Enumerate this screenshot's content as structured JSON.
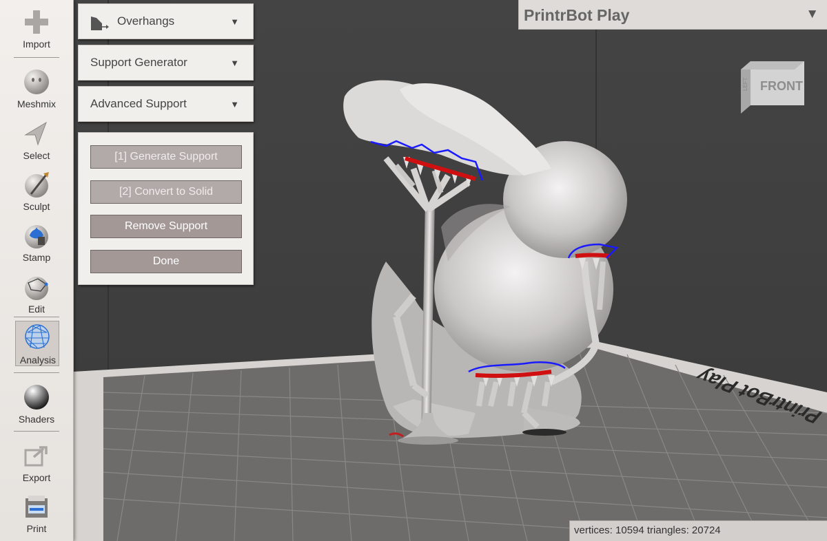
{
  "toolbar": {
    "items": [
      {
        "label": "Import",
        "icon": "plus-icon"
      },
      {
        "label": "Meshmix",
        "icon": "face-sphere-icon"
      },
      {
        "label": "Select",
        "icon": "cursor-arrow-icon"
      },
      {
        "label": "Sculpt",
        "icon": "brush-sphere-icon"
      },
      {
        "label": "Stamp",
        "icon": "stamp-icon"
      },
      {
        "label": "Edit",
        "icon": "edit-mesh-icon"
      },
      {
        "label": "Analysis",
        "icon": "analysis-mesh-icon",
        "active": true
      },
      {
        "label": "Shaders",
        "icon": "shader-ball-icon"
      },
      {
        "label": "Export",
        "icon": "export-icon"
      },
      {
        "label": "Print",
        "icon": "printer-icon"
      }
    ]
  },
  "panels": {
    "overhangs": "Overhangs",
    "support_generator": "Support Generator",
    "advanced_support": "Advanced Support"
  },
  "actions": {
    "generate": "[1] Generate Support",
    "convert": "[2] Convert to Solid",
    "remove": "Remove Support",
    "done": "Done"
  },
  "printer": {
    "name": "PrintrBot Play"
  },
  "view_cube": {
    "front": "FRONT",
    "left": "LEFT"
  },
  "bed": {
    "label": "PrintrBot Play"
  },
  "status": {
    "text": "vertices: 10594 triangles: 20724"
  },
  "colors": {
    "overhang_outline": "#1a1aff",
    "overhang_fill": "#d01010",
    "toolbar_bg": "#ece9e6",
    "button_bg": "#a39896"
  }
}
